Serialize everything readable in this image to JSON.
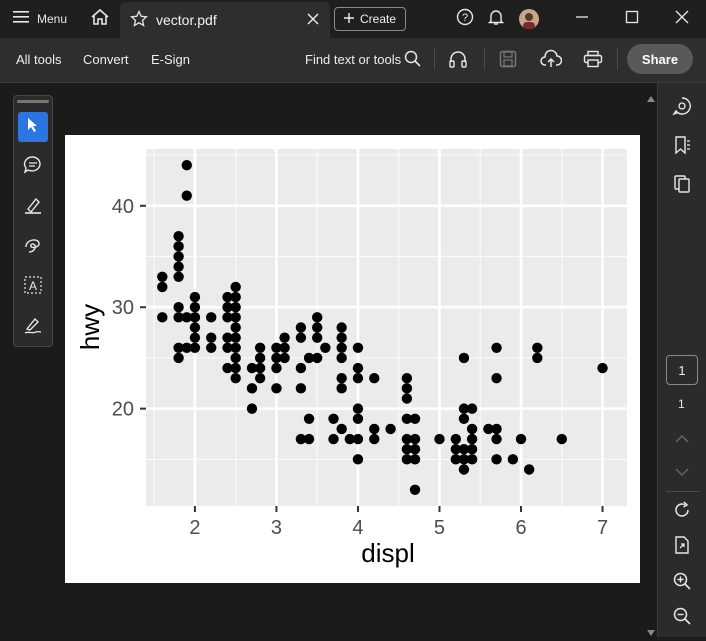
{
  "titlebar": {
    "menu_label": "Menu",
    "tab_title": "vector.pdf",
    "create_label": "Create"
  },
  "toolbar": {
    "all_tools": "All tools",
    "convert": "Convert",
    "esign": "E-Sign",
    "find_label": "Find text or tools",
    "share_label": "Share"
  },
  "pager": {
    "current_page": "1",
    "total_pages": "1"
  },
  "chart_data": {
    "type": "scatter",
    "xlabel": "displ",
    "ylabel": "hwy",
    "xlim": [
      1.4,
      7.3
    ],
    "ylim": [
      10.4,
      45.6
    ],
    "xticks": [
      2,
      3,
      4,
      5,
      6,
      7
    ],
    "yticks": [
      20,
      30,
      40
    ],
    "grid": true,
    "points": [
      [
        1.6,
        33
      ],
      [
        1.6,
        32
      ],
      [
        1.6,
        29
      ],
      [
        1.8,
        37
      ],
      [
        1.8,
        36
      ],
      [
        1.8,
        35
      ],
      [
        1.8,
        34
      ],
      [
        1.8,
        33
      ],
      [
        1.8,
        30
      ],
      [
        1.8,
        29
      ],
      [
        1.8,
        26
      ],
      [
        1.8,
        25
      ],
      [
        1.9,
        44
      ],
      [
        1.9,
        41
      ],
      [
        1.9,
        29
      ],
      [
        1.9,
        26
      ],
      [
        2.0,
        31
      ],
      [
        2.0,
        30
      ],
      [
        2.0,
        29
      ],
      [
        2.0,
        28
      ],
      [
        2.0,
        27
      ],
      [
        2.0,
        26
      ],
      [
        2.2,
        29
      ],
      [
        2.2,
        27
      ],
      [
        2.2,
        26
      ],
      [
        2.4,
        31
      ],
      [
        2.4,
        30
      ],
      [
        2.4,
        29
      ],
      [
        2.4,
        27
      ],
      [
        2.4,
        26
      ],
      [
        2.4,
        24
      ],
      [
        2.5,
        32
      ],
      [
        2.5,
        31
      ],
      [
        2.5,
        30
      ],
      [
        2.5,
        29
      ],
      [
        2.5,
        28
      ],
      [
        2.5,
        27
      ],
      [
        2.5,
        26
      ],
      [
        2.5,
        25
      ],
      [
        2.5,
        24
      ],
      [
        2.5,
        23
      ],
      [
        2.7,
        24
      ],
      [
        2.7,
        22
      ],
      [
        2.7,
        20
      ],
      [
        2.8,
        26
      ],
      [
        2.8,
        25
      ],
      [
        2.8,
        24
      ],
      [
        2.8,
        23
      ],
      [
        3.0,
        26
      ],
      [
        3.0,
        25
      ],
      [
        3.0,
        24
      ],
      [
        3.0,
        22
      ],
      [
        3.1,
        27
      ],
      [
        3.1,
        26
      ],
      [
        3.1,
        25
      ],
      [
        3.3,
        28
      ],
      [
        3.3,
        27
      ],
      [
        3.3,
        24
      ],
      [
        3.3,
        22
      ],
      [
        3.3,
        17
      ],
      [
        3.4,
        25
      ],
      [
        3.4,
        17
      ],
      [
        3.4,
        19
      ],
      [
        3.5,
        29
      ],
      [
        3.5,
        28
      ],
      [
        3.5,
        27
      ],
      [
        3.5,
        25
      ],
      [
        3.6,
        26
      ],
      [
        3.7,
        19
      ],
      [
        3.7,
        17
      ],
      [
        3.8,
        28
      ],
      [
        3.8,
        27
      ],
      [
        3.8,
        26
      ],
      [
        3.8,
        25
      ],
      [
        3.8,
        23
      ],
      [
        3.8,
        22
      ],
      [
        3.8,
        18
      ],
      [
        3.9,
        17
      ],
      [
        4.0,
        26
      ],
      [
        4.0,
        24
      ],
      [
        4.0,
        23
      ],
      [
        4.0,
        20
      ],
      [
        4.0,
        19
      ],
      [
        4.0,
        17
      ],
      [
        4.0,
        15
      ],
      [
        4.2,
        23
      ],
      [
        4.2,
        18
      ],
      [
        4.2,
        17
      ],
      [
        4.4,
        18
      ],
      [
        4.6,
        23
      ],
      [
        4.6,
        22
      ],
      [
        4.6,
        21
      ],
      [
        4.6,
        19
      ],
      [
        4.6,
        17
      ],
      [
        4.6,
        16
      ],
      [
        4.6,
        15
      ],
      [
        4.7,
        19
      ],
      [
        4.7,
        17
      ],
      [
        4.7,
        16
      ],
      [
        4.7,
        15
      ],
      [
        4.7,
        12
      ],
      [
        5.0,
        17
      ],
      [
        5.2,
        17
      ],
      [
        5.2,
        16
      ],
      [
        5.2,
        15
      ],
      [
        5.3,
        25
      ],
      [
        5.3,
        20
      ],
      [
        5.3,
        19
      ],
      [
        5.3,
        16
      ],
      [
        5.3,
        15
      ],
      [
        5.3,
        14
      ],
      [
        5.4,
        20
      ],
      [
        5.4,
        18
      ],
      [
        5.4,
        17
      ],
      [
        5.4,
        16
      ],
      [
        5.4,
        15
      ],
      [
        5.6,
        18
      ],
      [
        5.7,
        26
      ],
      [
        5.7,
        23
      ],
      [
        5.7,
        18
      ],
      [
        5.7,
        17
      ],
      [
        5.7,
        15
      ],
      [
        5.9,
        15
      ],
      [
        6.0,
        17
      ],
      [
        6.1,
        14
      ],
      [
        6.2,
        26
      ],
      [
        6.2,
        25
      ],
      [
        6.5,
        17
      ],
      [
        7.0,
        24
      ]
    ]
  }
}
